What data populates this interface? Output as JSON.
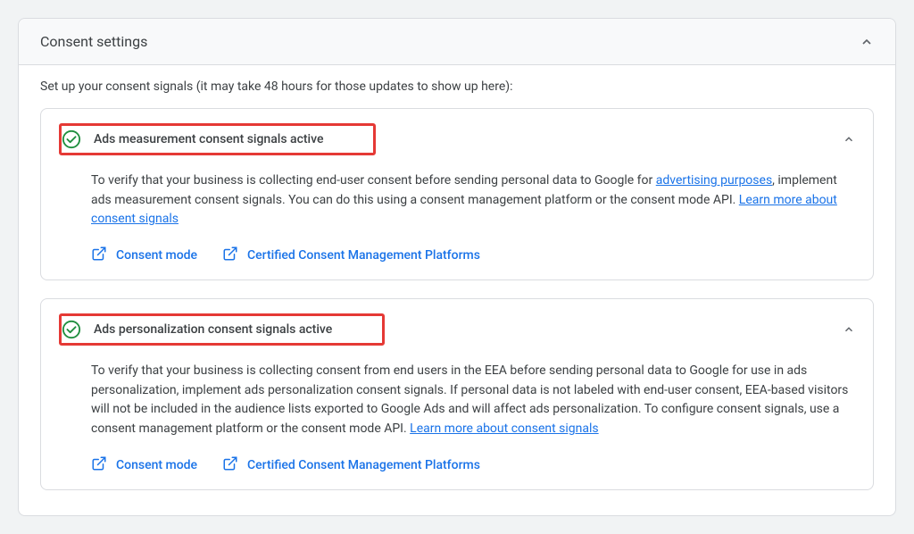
{
  "panel": {
    "title": "Consent settings",
    "intro": "Set up your consent signals (it may take 48 hours for those updates to show up here):"
  },
  "sections": {
    "measurement": {
      "title": "Ads measurement consent signals active",
      "desc_part1": "To verify that your business is collecting end-user consent before sending personal data to Google for ",
      "desc_link1": "advertising purposes",
      "desc_part2": ", implement ads measurement consent signals. You can do this using a consent management platform or the consent mode API. ",
      "desc_link2": "Learn more about consent signals"
    },
    "personalization": {
      "title": "Ads personalization consent signals active",
      "desc_part1": "To verify that your business is collecting consent from end users in the EEA before sending personal data to Google for use in ads personalization, implement ads personalization consent signals. If personal data is not labeled with end-user consent, EEA-based visitors will not be included in the audience lists exported to Google Ads and will affect ads personalization. To configure consent signals, use a consent management platform or the consent mode API. ",
      "desc_link1": "Learn more about consent signals"
    }
  },
  "actions": {
    "consent_mode": "Consent mode",
    "ccmp": "Certified Consent Management Platforms"
  }
}
